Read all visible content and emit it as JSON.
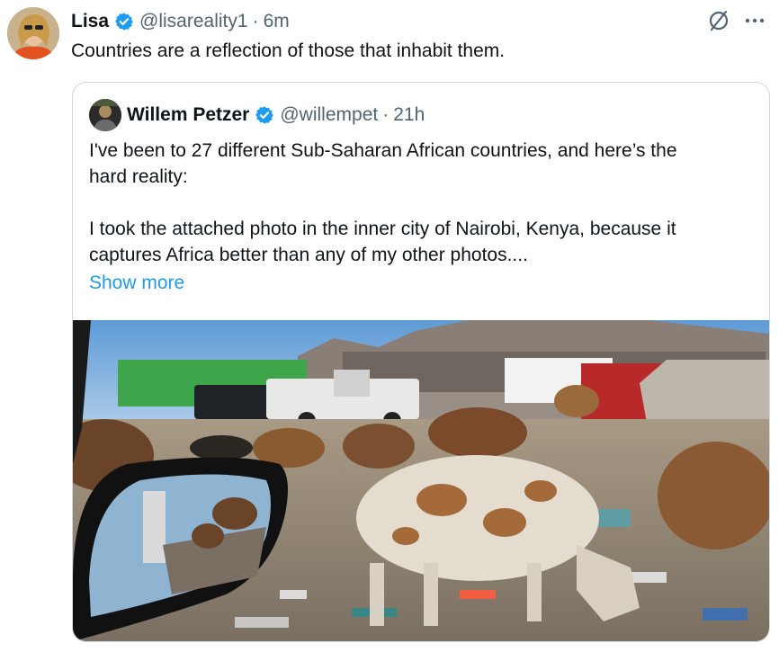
{
  "tweet": {
    "author_name": "Lisa",
    "handle": "@lisareality1",
    "separator": "·",
    "time": "6m",
    "text": "Countries are a reflection of those that inhabit them."
  },
  "quote": {
    "author_name": "Willem Petzer",
    "handle": "@willempet",
    "separator": "·",
    "time": "21h",
    "line1": "I've been to 27 different Sub-Saharan African countries, and here’s the",
    "line2": "hard reality:",
    "line3": "I took the attached photo in the inner city of Nairobi, Kenya, because it",
    "line4": "captures Africa better than any of my other photos....",
    "show_more": "Show more"
  },
  "icons": {
    "verified": "verified-badge-icon",
    "grok": "slash-circle-icon",
    "more": "more-dots-icon"
  },
  "colors": {
    "accent": "#1d9bf0",
    "muted": "#536471",
    "border": "#cfd9de"
  }
}
